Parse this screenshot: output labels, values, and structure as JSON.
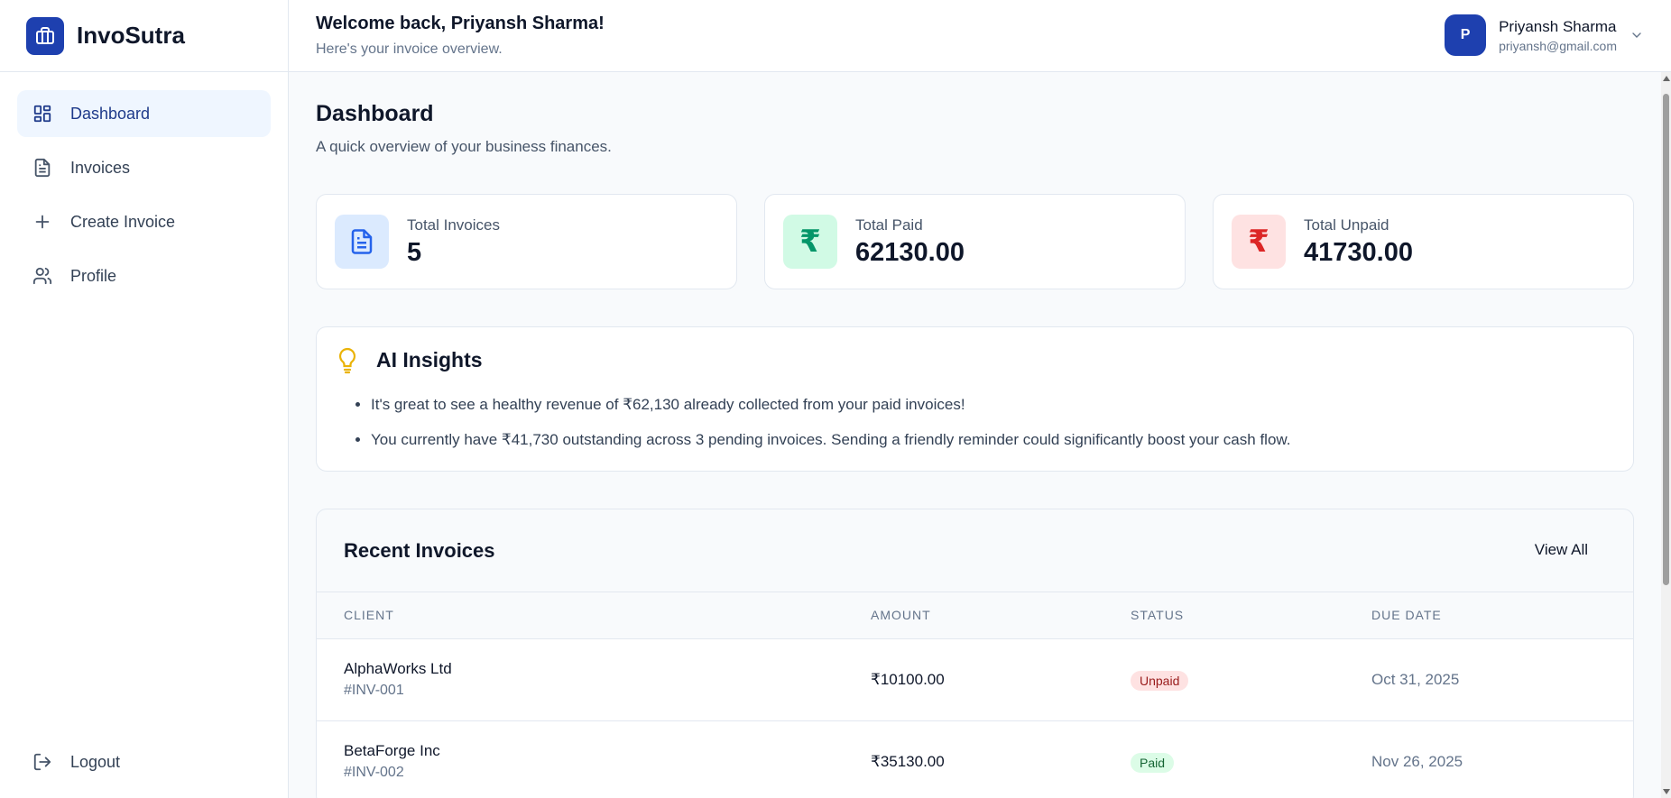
{
  "brand": {
    "name": "InvoSutra"
  },
  "sidebar": {
    "items": [
      {
        "label": "Dashboard",
        "icon": "dashboard-icon",
        "active": true
      },
      {
        "label": "Invoices",
        "icon": "document-icon"
      },
      {
        "label": "Create Invoice",
        "icon": "plus-icon"
      },
      {
        "label": "Profile",
        "icon": "users-icon"
      }
    ],
    "logout": "Logout"
  },
  "header": {
    "welcome": "Welcome back, Priyansh Sharma!",
    "subtitle": "Here's your invoice overview.",
    "user": {
      "initial": "P",
      "name": "Priyansh Sharma",
      "email": "priyansh@gmail.com"
    }
  },
  "page": {
    "title": "Dashboard",
    "subtitle": "A quick overview of your business finances."
  },
  "stats": [
    {
      "label": "Total Invoices",
      "value": "5",
      "icon": "document-icon",
      "icon_color": "#2563eb",
      "icon_bg": "#dbeafe"
    },
    {
      "label": "Total Paid",
      "value": "62130.00",
      "icon": "rupee-icon",
      "icon_glyph": "₹",
      "icon_color": "#059669",
      "icon_bg": "#d1fae5"
    },
    {
      "label": "Total Unpaid",
      "value": "41730.00",
      "icon": "rupee-icon",
      "icon_glyph": "₹",
      "icon_color": "#dc2626",
      "icon_bg": "#fee2e2"
    }
  ],
  "insights": {
    "title": "AI Insights",
    "icon": "lightbulb-icon",
    "items": [
      "It's great to see a healthy revenue of ₹62,130 already collected from your paid invoices!",
      "You currently have ₹41,730 outstanding across 3 pending invoices. Sending a friendly reminder could significantly boost your cash flow."
    ]
  },
  "recent": {
    "title": "Recent Invoices",
    "view_all": "View All",
    "columns": [
      "CLIENT",
      "AMOUNT",
      "STATUS",
      "DUE DATE"
    ],
    "rows": [
      {
        "client": "AlphaWorks Ltd",
        "id": "#INV-001",
        "amount": "₹10100.00",
        "status": "Unpaid",
        "due": "Oct 31, 2025"
      },
      {
        "client": "BetaForge Inc",
        "id": "#INV-002",
        "amount": "₹35130.00",
        "status": "Paid",
        "due": "Nov 26, 2025"
      }
    ]
  },
  "colors": {
    "accent": "#1e40af",
    "active_bg": "#eff6ff",
    "border": "#e2e8f0"
  }
}
